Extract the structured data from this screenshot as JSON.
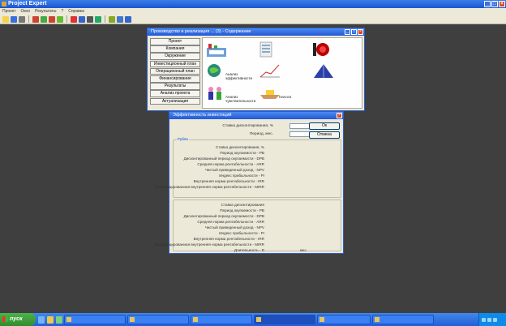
{
  "app": {
    "title": "Project Expert",
    "menu": [
      "Проект",
      "Окно",
      "Результаты",
      "?",
      "Справка"
    ],
    "toolbar_icons": [
      "open-icon",
      "save-icon",
      "print-icon",
      "cut-icon",
      "copy-icon",
      "paste-icon",
      "calc-icon",
      "chart-icon",
      "table-icon",
      "graph-icon",
      "report-icon",
      "settings-icon",
      "window-icon",
      "help-icon"
    ]
  },
  "contents_dialog": {
    "title": "Производство и реализация ... (3) - Содержание",
    "menu": [
      "Проект",
      "Компания",
      "Окружение",
      "Инвестиционный план",
      "Операционный план",
      "Финансирование",
      "Результаты",
      "Анализ проекта",
      "Актуализация"
    ],
    "tiles": [
      {
        "icon": "factory-icon",
        "caption": ""
      },
      {
        "icon": "list-icon",
        "caption": ""
      },
      {
        "icon": "target-icon",
        "caption": ""
      },
      {
        "icon": "globe-icon",
        "caption": "Анализ эффективности"
      },
      {
        "icon": "graph-icon",
        "caption": ""
      },
      {
        "icon": "mountain-icon",
        "caption": ""
      },
      {
        "icon": "people-icon",
        "caption": "Анализ чувствительности"
      },
      {
        "icon": "boat-icon",
        "caption": "Налоги"
      }
    ]
  },
  "calc_dialog": {
    "title": "Эффективность инвестиций",
    "header": [
      {
        "label": "Ставка дисконтирования, %",
        "value": "",
        "button": "Ок"
      },
      {
        "label": "Период, мес.",
        "value": "",
        "button": "Отмена"
      }
    ],
    "group1_label": "Рубли",
    "group1_rows": [
      {
        "label": "Ставка дисконтирования, %",
        "value": "",
        "unit": ""
      },
      {
        "label": "Период окупаемости - PB",
        "value": "",
        "unit": ""
      },
      {
        "label": "Дисконтированный период окупаемости - DPB",
        "value": "",
        "unit": ""
      },
      {
        "label": "Средняя норма рентабельности - ARR",
        "value": "",
        "unit": ""
      },
      {
        "label": "Чистый приведенный доход - NPV",
        "value": "",
        "unit": ""
      },
      {
        "label": "Индекс прибыльности - PI",
        "value": "",
        "unit": ""
      },
      {
        "label": "Внутренняя норма рентабельности - IRR",
        "value": "",
        "unit": ""
      },
      {
        "label": "Модифицированная внутренняя норма рентабельности - MIRR",
        "value": "",
        "unit": ""
      }
    ],
    "group2_label": "",
    "group2_rows": [
      {
        "label": "Ставка дисконтирования",
        "value": "",
        "unit": ""
      },
      {
        "label": "Период окупаемости - PB",
        "value": "",
        "unit": ""
      },
      {
        "label": "Дисконтированный период окупаемости - DPB",
        "value": "",
        "unit": ""
      },
      {
        "label": "Средняя норма рентабельности - ARR",
        "value": "",
        "unit": ""
      },
      {
        "label": "Чистый приведенный доход - NPV",
        "value": "",
        "unit": ""
      },
      {
        "label": "Индекс прибыльности - PI",
        "value": "",
        "unit": ""
      },
      {
        "label": "Внутренняя норма рентабельности - IRR",
        "value": "",
        "unit": ""
      },
      {
        "label": "Модифицированная внутренняя норма рентабельности - MIRR",
        "value": "",
        "unit": ""
      },
      {
        "label": "Длительность - D",
        "value": "",
        "unit": "мес."
      }
    ]
  },
  "taskbar": {
    "start": "пуск",
    "tasks": [
      {
        "label": "",
        "active": false
      },
      {
        "label": "",
        "active": false
      },
      {
        "label": "",
        "active": false
      },
      {
        "label": "",
        "active": true
      },
      {
        "label": "",
        "active": false
      },
      {
        "label": "",
        "active": false
      }
    ],
    "clock": ""
  },
  "colors": {
    "titlebar": "#2258d6",
    "dialog_bg": "#ece9d8",
    "workspace": "#3f3f3f",
    "taskbar": "#245edb",
    "start": "#318b2e"
  }
}
